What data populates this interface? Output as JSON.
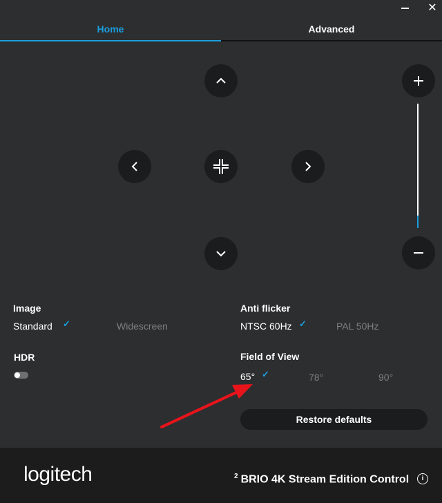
{
  "window": {
    "minimize_icon": "minimize-icon",
    "close_icon": "close-icon",
    "close_glyph": "✕"
  },
  "tabs": [
    {
      "label": "Home",
      "active": true
    },
    {
      "label": "Advanced",
      "active": false
    }
  ],
  "pan_tilt": {
    "up_icon": "chevron-up-icon",
    "down_icon": "chevron-down-icon",
    "left_icon": "chevron-left-icon",
    "right_icon": "chevron-right-icon",
    "center_icon": "recenter-icon"
  },
  "zoom": {
    "plus_icon": "plus-icon",
    "minus_icon": "minus-icon",
    "level_fraction": 0.1
  },
  "image": {
    "label": "Image",
    "options": [
      {
        "label": "Standard",
        "selected": true
      },
      {
        "label": "Widescreen",
        "selected": false
      }
    ]
  },
  "anti_flicker": {
    "label": "Anti flicker",
    "options": [
      {
        "label": "NTSC 60Hz",
        "selected": true
      },
      {
        "label": "PAL 50Hz",
        "selected": false
      }
    ]
  },
  "hdr": {
    "label": "HDR",
    "enabled": false
  },
  "field_of_view": {
    "label": "Field of View",
    "options": [
      {
        "label": "65°",
        "selected": true
      },
      {
        "label": "78°",
        "selected": false
      },
      {
        "label": "90°",
        "selected": false
      }
    ]
  },
  "check_glyph": "✓",
  "restore_label": "Restore defaults",
  "footer": {
    "logo": "logitech",
    "superscript": "2",
    "product": "BRIO 4K Stream Edition Control",
    "info_glyph": "i"
  },
  "colors": {
    "accent": "#1a9ede",
    "background": "#2d2e30",
    "button": "#1b1c1e",
    "annotation_arrow": "#e8141b"
  }
}
